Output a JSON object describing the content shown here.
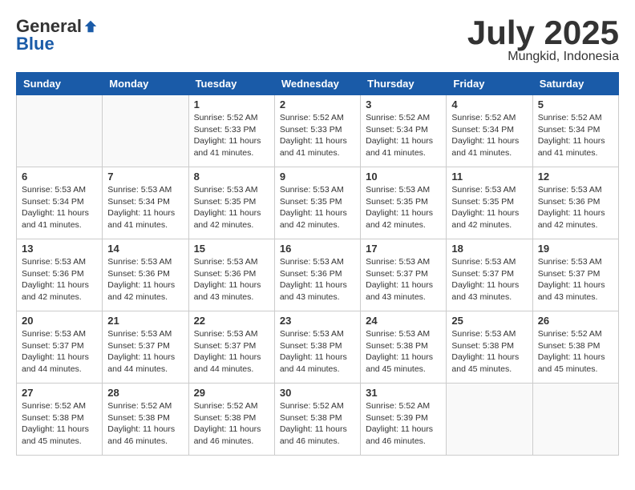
{
  "header": {
    "logo": {
      "general": "General",
      "blue": "Blue"
    },
    "title": "July 2025",
    "location": "Mungkid, Indonesia"
  },
  "weekdays": [
    "Sunday",
    "Monday",
    "Tuesday",
    "Wednesday",
    "Thursday",
    "Friday",
    "Saturday"
  ],
  "weeks": [
    [
      {
        "day": "",
        "info": ""
      },
      {
        "day": "",
        "info": ""
      },
      {
        "day": "1",
        "info": "Sunrise: 5:52 AM\nSunset: 5:33 PM\nDaylight: 11 hours and 41 minutes."
      },
      {
        "day": "2",
        "info": "Sunrise: 5:52 AM\nSunset: 5:33 PM\nDaylight: 11 hours and 41 minutes."
      },
      {
        "day": "3",
        "info": "Sunrise: 5:52 AM\nSunset: 5:34 PM\nDaylight: 11 hours and 41 minutes."
      },
      {
        "day": "4",
        "info": "Sunrise: 5:52 AM\nSunset: 5:34 PM\nDaylight: 11 hours and 41 minutes."
      },
      {
        "day": "5",
        "info": "Sunrise: 5:52 AM\nSunset: 5:34 PM\nDaylight: 11 hours and 41 minutes."
      }
    ],
    [
      {
        "day": "6",
        "info": "Sunrise: 5:53 AM\nSunset: 5:34 PM\nDaylight: 11 hours and 41 minutes."
      },
      {
        "day": "7",
        "info": "Sunrise: 5:53 AM\nSunset: 5:34 PM\nDaylight: 11 hours and 41 minutes."
      },
      {
        "day": "8",
        "info": "Sunrise: 5:53 AM\nSunset: 5:35 PM\nDaylight: 11 hours and 42 minutes."
      },
      {
        "day": "9",
        "info": "Sunrise: 5:53 AM\nSunset: 5:35 PM\nDaylight: 11 hours and 42 minutes."
      },
      {
        "day": "10",
        "info": "Sunrise: 5:53 AM\nSunset: 5:35 PM\nDaylight: 11 hours and 42 minutes."
      },
      {
        "day": "11",
        "info": "Sunrise: 5:53 AM\nSunset: 5:35 PM\nDaylight: 11 hours and 42 minutes."
      },
      {
        "day": "12",
        "info": "Sunrise: 5:53 AM\nSunset: 5:36 PM\nDaylight: 11 hours and 42 minutes."
      }
    ],
    [
      {
        "day": "13",
        "info": "Sunrise: 5:53 AM\nSunset: 5:36 PM\nDaylight: 11 hours and 42 minutes."
      },
      {
        "day": "14",
        "info": "Sunrise: 5:53 AM\nSunset: 5:36 PM\nDaylight: 11 hours and 42 minutes."
      },
      {
        "day": "15",
        "info": "Sunrise: 5:53 AM\nSunset: 5:36 PM\nDaylight: 11 hours and 43 minutes."
      },
      {
        "day": "16",
        "info": "Sunrise: 5:53 AM\nSunset: 5:36 PM\nDaylight: 11 hours and 43 minutes."
      },
      {
        "day": "17",
        "info": "Sunrise: 5:53 AM\nSunset: 5:37 PM\nDaylight: 11 hours and 43 minutes."
      },
      {
        "day": "18",
        "info": "Sunrise: 5:53 AM\nSunset: 5:37 PM\nDaylight: 11 hours and 43 minutes."
      },
      {
        "day": "19",
        "info": "Sunrise: 5:53 AM\nSunset: 5:37 PM\nDaylight: 11 hours and 43 minutes."
      }
    ],
    [
      {
        "day": "20",
        "info": "Sunrise: 5:53 AM\nSunset: 5:37 PM\nDaylight: 11 hours and 44 minutes."
      },
      {
        "day": "21",
        "info": "Sunrise: 5:53 AM\nSunset: 5:37 PM\nDaylight: 11 hours and 44 minutes."
      },
      {
        "day": "22",
        "info": "Sunrise: 5:53 AM\nSunset: 5:37 PM\nDaylight: 11 hours and 44 minutes."
      },
      {
        "day": "23",
        "info": "Sunrise: 5:53 AM\nSunset: 5:38 PM\nDaylight: 11 hours and 44 minutes."
      },
      {
        "day": "24",
        "info": "Sunrise: 5:53 AM\nSunset: 5:38 PM\nDaylight: 11 hours and 45 minutes."
      },
      {
        "day": "25",
        "info": "Sunrise: 5:53 AM\nSunset: 5:38 PM\nDaylight: 11 hours and 45 minutes."
      },
      {
        "day": "26",
        "info": "Sunrise: 5:52 AM\nSunset: 5:38 PM\nDaylight: 11 hours and 45 minutes."
      }
    ],
    [
      {
        "day": "27",
        "info": "Sunrise: 5:52 AM\nSunset: 5:38 PM\nDaylight: 11 hours and 45 minutes."
      },
      {
        "day": "28",
        "info": "Sunrise: 5:52 AM\nSunset: 5:38 PM\nDaylight: 11 hours and 46 minutes."
      },
      {
        "day": "29",
        "info": "Sunrise: 5:52 AM\nSunset: 5:38 PM\nDaylight: 11 hours and 46 minutes."
      },
      {
        "day": "30",
        "info": "Sunrise: 5:52 AM\nSunset: 5:38 PM\nDaylight: 11 hours and 46 minutes."
      },
      {
        "day": "31",
        "info": "Sunrise: 5:52 AM\nSunset: 5:39 PM\nDaylight: 11 hours and 46 minutes."
      },
      {
        "day": "",
        "info": ""
      },
      {
        "day": "",
        "info": ""
      }
    ]
  ]
}
